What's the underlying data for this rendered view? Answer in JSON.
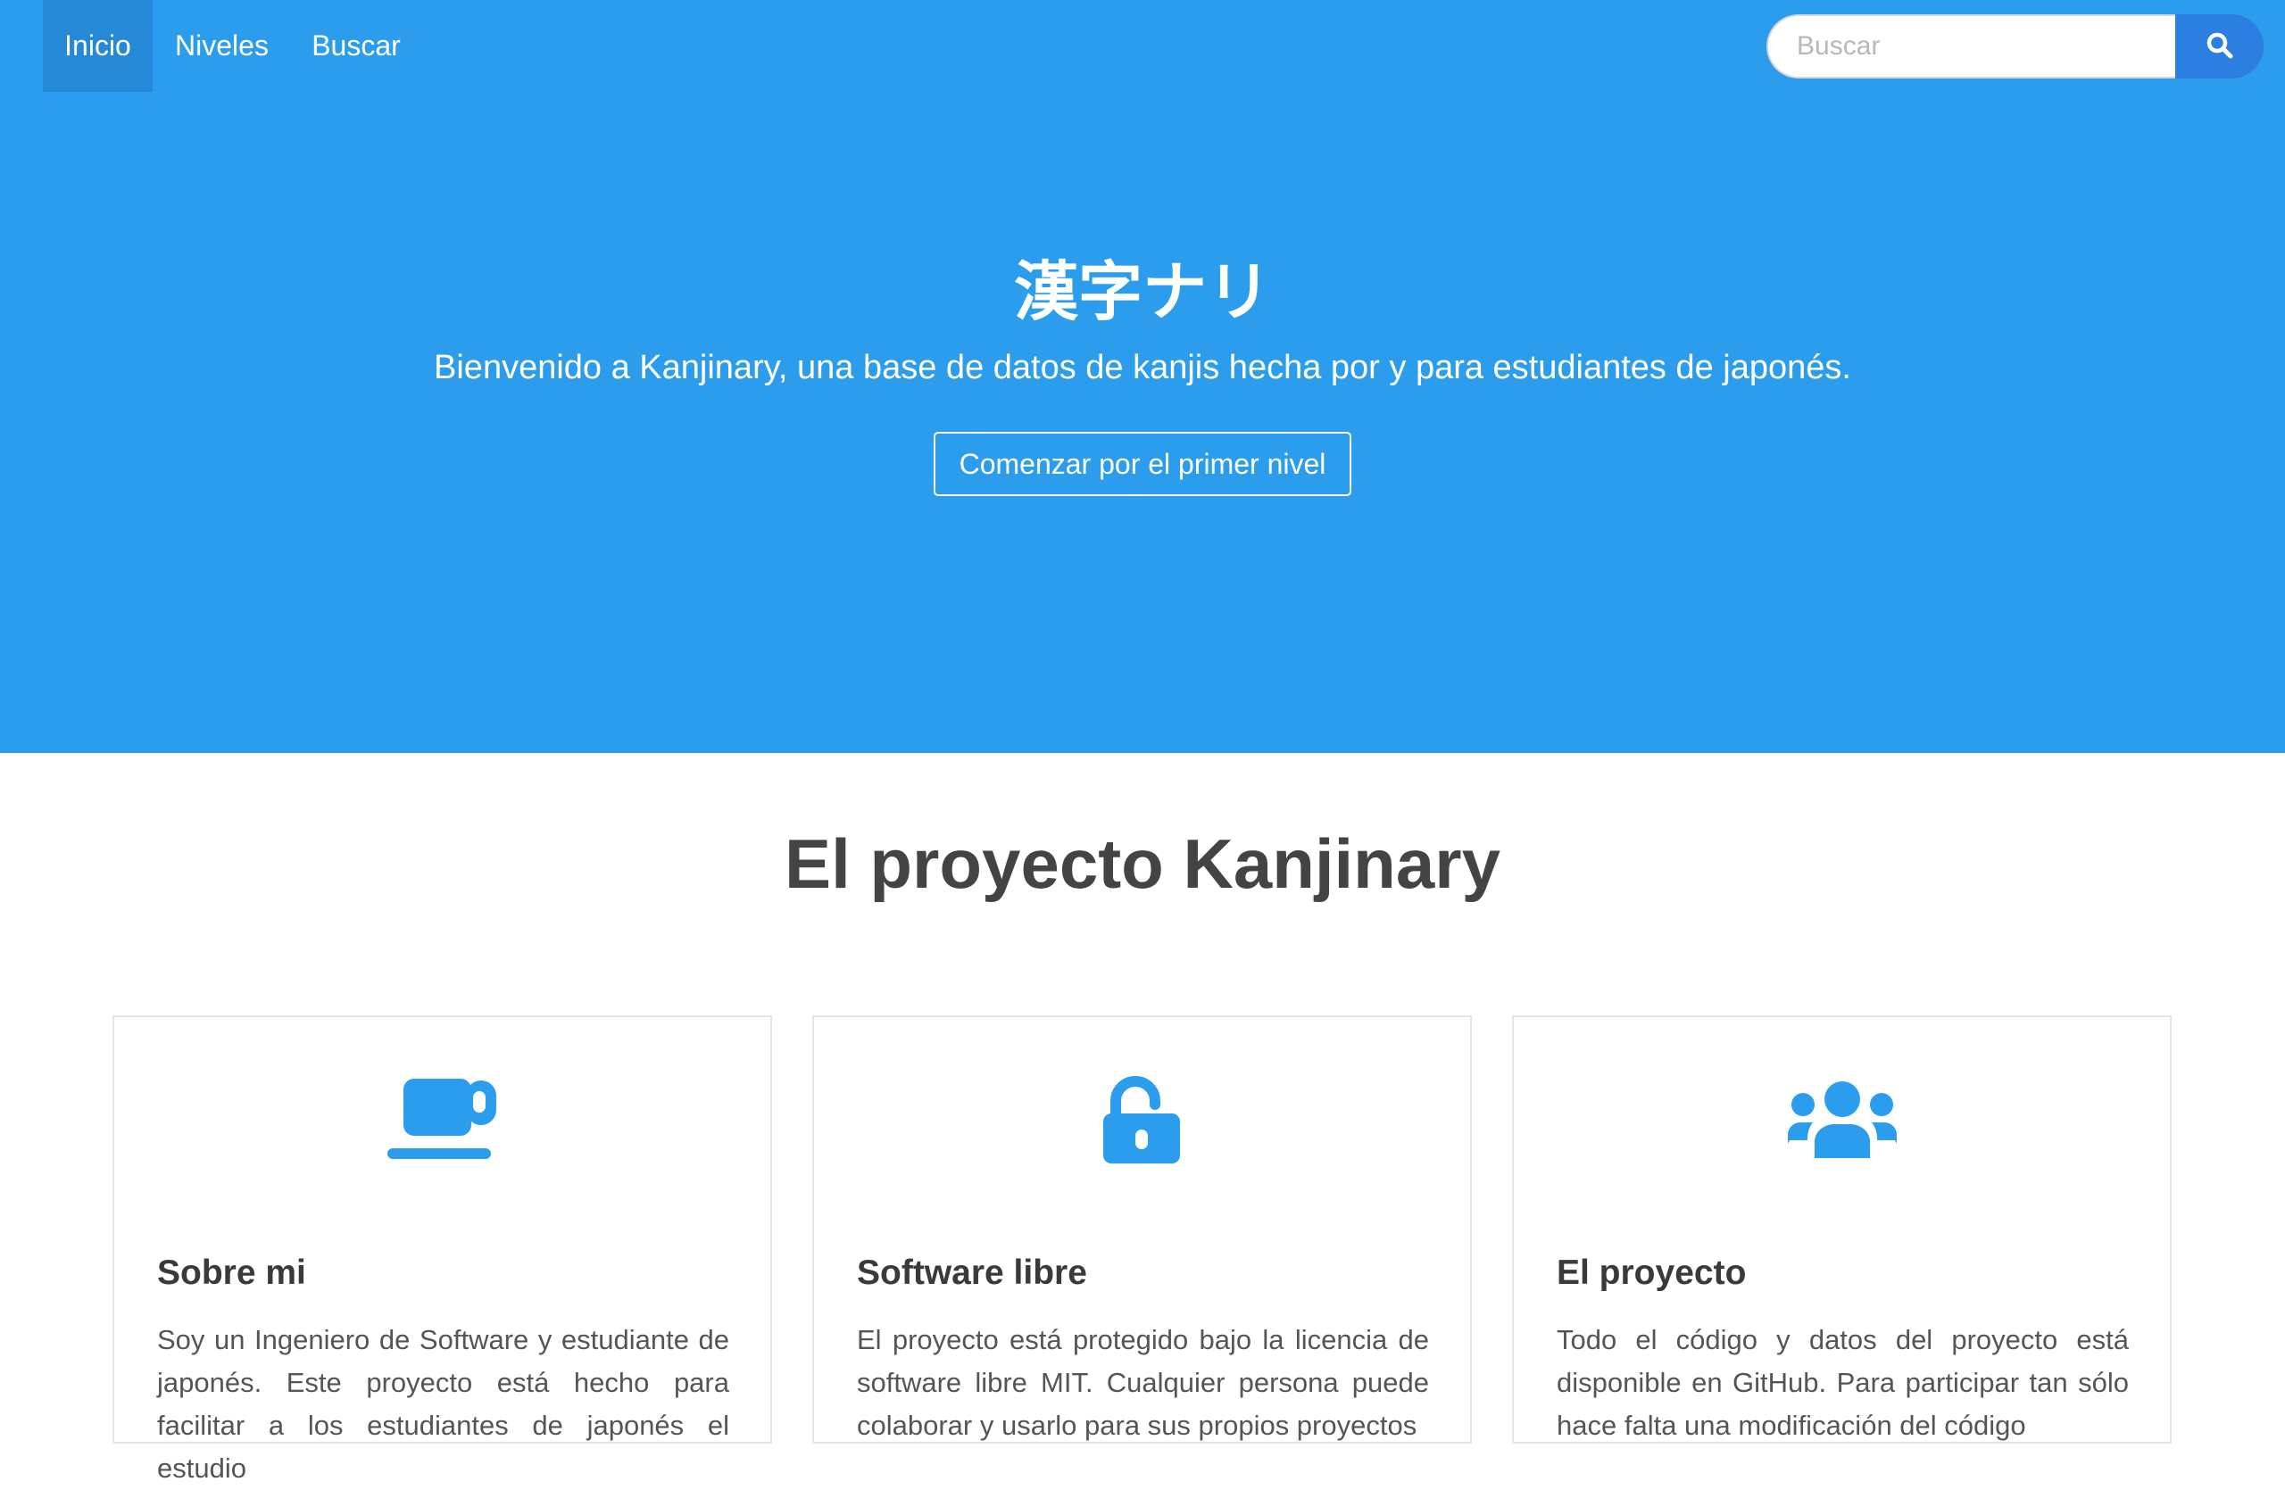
{
  "nav": {
    "items": [
      {
        "label": "Inicio",
        "active": true
      },
      {
        "label": "Niveles",
        "active": false
      },
      {
        "label": "Buscar",
        "active": false
      }
    ],
    "search": {
      "placeholder": "Buscar",
      "value": "",
      "button_icon": "search-icon"
    }
  },
  "hero": {
    "title": "漢字ナリ",
    "subtitle": "Bienvenido a Kanjinary, una base de datos de kanjis hecha por y para estudiantes de japonés.",
    "cta_label": "Comenzar por el primer nivel"
  },
  "section": {
    "title": "El proyecto Kanjinary",
    "cards": [
      {
        "icon": "coffee-cup-icon",
        "title": "Sobre mi",
        "text": "Soy un Ingeniero de Software y estudiante de japonés. Este proyecto está hecho para facilitar a los estudiantes de japonés el estudio"
      },
      {
        "icon": "unlock-icon",
        "title": "Software libre",
        "text": "El proyecto está protegido bajo la licencia de software libre MIT. Cualquier persona puede colaborar y usarlo para sus propios proyectos"
      },
      {
        "icon": "users-icon",
        "title": "El proyecto",
        "text": "Todo el código y datos del proyecto está disponible en GitHub. Para participar tan sólo hace falta una modificación del código"
      }
    ]
  },
  "colors": {
    "hero_bg": "#2c9dec",
    "nav_active_bg": "#2589d8",
    "search_button_bg": "#2a7fe0",
    "icon_color": "#2c9dec"
  }
}
